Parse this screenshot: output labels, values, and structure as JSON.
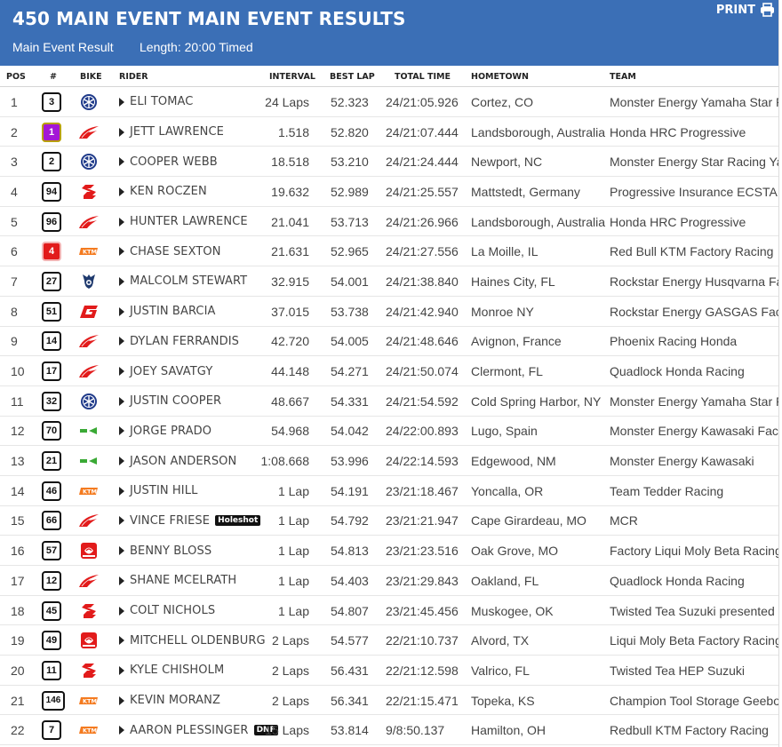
{
  "header": {
    "title": "450 MAIN EVENT MAIN EVENT RESULTS",
    "subtitle_left": "Main Event Result",
    "subtitle_right": "Length: 20:00 Timed",
    "print_label": "PRINT"
  },
  "columns": {
    "pos": "POS",
    "num": "#",
    "bike": "BIKE",
    "rider": "RIDER",
    "interval": "INTERVAL",
    "best_lap": "BEST LAP",
    "total_time": "TOTAL TIME",
    "hometown": "HOMETOWN",
    "team": "TEAM"
  },
  "colors": {
    "header_bg": "#3b6fb6",
    "yamaha": "#1f3a8a",
    "honda": "#e21b1b",
    "suzuki": "#e21b1b",
    "ktm": "#f47b20",
    "husqvarna": "#1f3a6e",
    "gasgas": "#e21b1b",
    "kawasaki": "#3aa935",
    "beta": "#e21b1b"
  },
  "rows": [
    {
      "pos": "1",
      "num": "3",
      "plate": "white",
      "bike": "yamaha-logo-icon",
      "rider": "ELI TOMAC",
      "tag": "",
      "interval": "24 Laps",
      "best": "52.323",
      "total": "24/21:05.926",
      "home": "Cortez, CO",
      "team": "Monster Energy Yamaha Star Racing"
    },
    {
      "pos": "2",
      "num": "1",
      "plate": "purple",
      "bike": "honda-logo-icon",
      "rider": "JETT LAWRENCE",
      "tag": "",
      "interval": "1.518",
      "best": "52.820",
      "total": "24/21:07.444",
      "home": "Landsborough, Australia",
      "team": "Honda HRC Progressive"
    },
    {
      "pos": "3",
      "num": "2",
      "plate": "white",
      "bike": "yamaha-logo-icon",
      "rider": "COOPER WEBB",
      "tag": "",
      "interval": "18.518",
      "best": "53.210",
      "total": "24/21:24.444",
      "home": "Newport, NC",
      "team": "Monster Energy Star Racing Yamaha"
    },
    {
      "pos": "4",
      "num": "94",
      "plate": "white",
      "bike": "suzuki-logo-icon",
      "rider": "KEN ROCZEN",
      "tag": "",
      "interval": "19.632",
      "best": "52.989",
      "total": "24/21:25.557",
      "home": "Mattstedt, Germany",
      "team": "Progressive Insurance ECSTAR Suzuki"
    },
    {
      "pos": "5",
      "num": "96",
      "plate": "white",
      "bike": "honda-logo-icon",
      "rider": "HUNTER LAWRENCE",
      "tag": "",
      "interval": "21.041",
      "best": "53.713",
      "total": "24/21:26.966",
      "home": "Landsborough, Australia",
      "team": "Honda HRC Progressive"
    },
    {
      "pos": "6",
      "num": "4",
      "plate": "red",
      "bike": "ktm-logo-icon",
      "rider": "CHASE SEXTON",
      "tag": "",
      "interval": "21.631",
      "best": "52.965",
      "total": "24/21:27.556",
      "home": "La Moille, IL",
      "team": "Red Bull KTM Factory Racing"
    },
    {
      "pos": "7",
      "num": "27",
      "plate": "white",
      "bike": "husqvarna-logo-icon",
      "rider": "MALCOLM STEWART",
      "tag": "",
      "interval": "32.915",
      "best": "54.001",
      "total": "24/21:38.840",
      "home": "Haines City, FL",
      "team": "Rockstar Energy Husqvarna Factory Racing"
    },
    {
      "pos": "8",
      "num": "51",
      "plate": "white",
      "bike": "gasgas-logo-icon",
      "rider": "JUSTIN BARCIA",
      "tag": "",
      "interval": "37.015",
      "best": "53.738",
      "total": "24/21:42.940",
      "home": "Monroe NY",
      "team": "Rockstar Energy GASGAS Factory Racing"
    },
    {
      "pos": "9",
      "num": "14",
      "plate": "white",
      "bike": "honda-logo-icon",
      "rider": "DYLAN FERRANDIS",
      "tag": "",
      "interval": "42.720",
      "best": "54.005",
      "total": "24/21:48.646",
      "home": "Avignon, France",
      "team": "Phoenix Racing Honda"
    },
    {
      "pos": "10",
      "num": "17",
      "plate": "white",
      "bike": "honda-logo-icon",
      "rider": "JOEY SAVATGY",
      "tag": "",
      "interval": "44.148",
      "best": "54.271",
      "total": "24/21:50.074",
      "home": "Clermont, FL",
      "team": "Quadlock Honda Racing"
    },
    {
      "pos": "11",
      "num": "32",
      "plate": "white",
      "bike": "yamaha-logo-icon",
      "rider": "JUSTIN COOPER",
      "tag": "",
      "interval": "48.667",
      "best": "54.331",
      "total": "24/21:54.592",
      "home": "Cold Spring Harbor, NY",
      "team": "Monster Energy Yamaha Star Racing"
    },
    {
      "pos": "12",
      "num": "70",
      "plate": "white",
      "bike": "kawasaki-logo-icon",
      "rider": "JORGE PRADO",
      "tag": "",
      "interval": "54.968",
      "best": "54.042",
      "total": "24/22:00.893",
      "home": "Lugo, Spain",
      "team": "Monster Energy Kawasaki Factory Racing"
    },
    {
      "pos": "13",
      "num": "21",
      "plate": "white",
      "bike": "kawasaki-logo-icon",
      "rider": "JASON ANDERSON",
      "tag": "",
      "interval": "1:08.668",
      "best": "53.996",
      "total": "24/22:14.593",
      "home": "Edgewood, NM",
      "team": "Monster Energy Kawasaki"
    },
    {
      "pos": "14",
      "num": "46",
      "plate": "white",
      "bike": "ktm-logo-icon",
      "rider": "JUSTIN HILL",
      "tag": "",
      "interval": "1 Lap",
      "best": "54.191",
      "total": "23/21:18.467",
      "home": "Yoncalla, OR",
      "team": "Team Tedder Racing"
    },
    {
      "pos": "15",
      "num": "66",
      "plate": "white",
      "bike": "honda-logo-icon",
      "rider": "VINCE FRIESE",
      "tag": "Holeshot",
      "interval": "1 Lap",
      "best": "54.792",
      "total": "23/21:21.947",
      "home": "Cape Girardeau, MO",
      "team": "MCR"
    },
    {
      "pos": "16",
      "num": "57",
      "plate": "white",
      "bike": "beta-logo-icon",
      "rider": "BENNY BLOSS",
      "tag": "",
      "interval": "1 Lap",
      "best": "54.813",
      "total": "23/21:23.516",
      "home": "Oak Grove, MO",
      "team": "Factory Liqui Moly Beta Racing"
    },
    {
      "pos": "17",
      "num": "12",
      "plate": "white",
      "bike": "honda-logo-icon",
      "rider": "SHANE MCELRATH",
      "tag": "",
      "interval": "1 Lap",
      "best": "54.403",
      "total": "23/21:29.843",
      "home": "Oakland, FL",
      "team": "Quadlock Honda Racing"
    },
    {
      "pos": "18",
      "num": "45",
      "plate": "white",
      "bike": "suzuki-logo-icon",
      "rider": "COLT NICHOLS",
      "tag": "",
      "interval": "1 Lap",
      "best": "54.807",
      "total": "23/21:45.456",
      "home": "Muskogee, OK",
      "team": "Twisted Tea Suzuki presented by Progressive"
    },
    {
      "pos": "19",
      "num": "49",
      "plate": "white",
      "bike": "beta-logo-icon",
      "rider": "MITCHELL OLDENBURG",
      "tag": "",
      "interval": "2 Laps",
      "best": "54.577",
      "total": "22/21:10.737",
      "home": "Alvord, TX",
      "team": "Liqui Moly Beta Factory Racing"
    },
    {
      "pos": "20",
      "num": "11",
      "plate": "white",
      "bike": "suzuki-logo-icon",
      "rider": "KYLE CHISHOLM",
      "tag": "",
      "interval": "2 Laps",
      "best": "56.431",
      "total": "22/21:12.598",
      "home": "Valrico, FL",
      "team": "Twisted Tea HEP Suzuki"
    },
    {
      "pos": "21",
      "num": "146",
      "plate": "white",
      "bike": "ktm-logo-icon",
      "rider": "KEVIN MORANZ",
      "tag": "",
      "interval": "2 Laps",
      "best": "56.341",
      "total": "22/21:15.471",
      "home": "Topeka, KS",
      "team": "Champion Tool Storage Geebo KMT"
    },
    {
      "pos": "22",
      "num": "7",
      "plate": "white",
      "bike": "ktm-logo-icon",
      "rider": "AARON PLESSINGER",
      "tag": "DNF",
      "interval": "15 Laps",
      "best": "53.814",
      "total": "9/8:50.137",
      "home": "Hamilton, OH",
      "team": "Redbull KTM Factory Racing"
    }
  ]
}
